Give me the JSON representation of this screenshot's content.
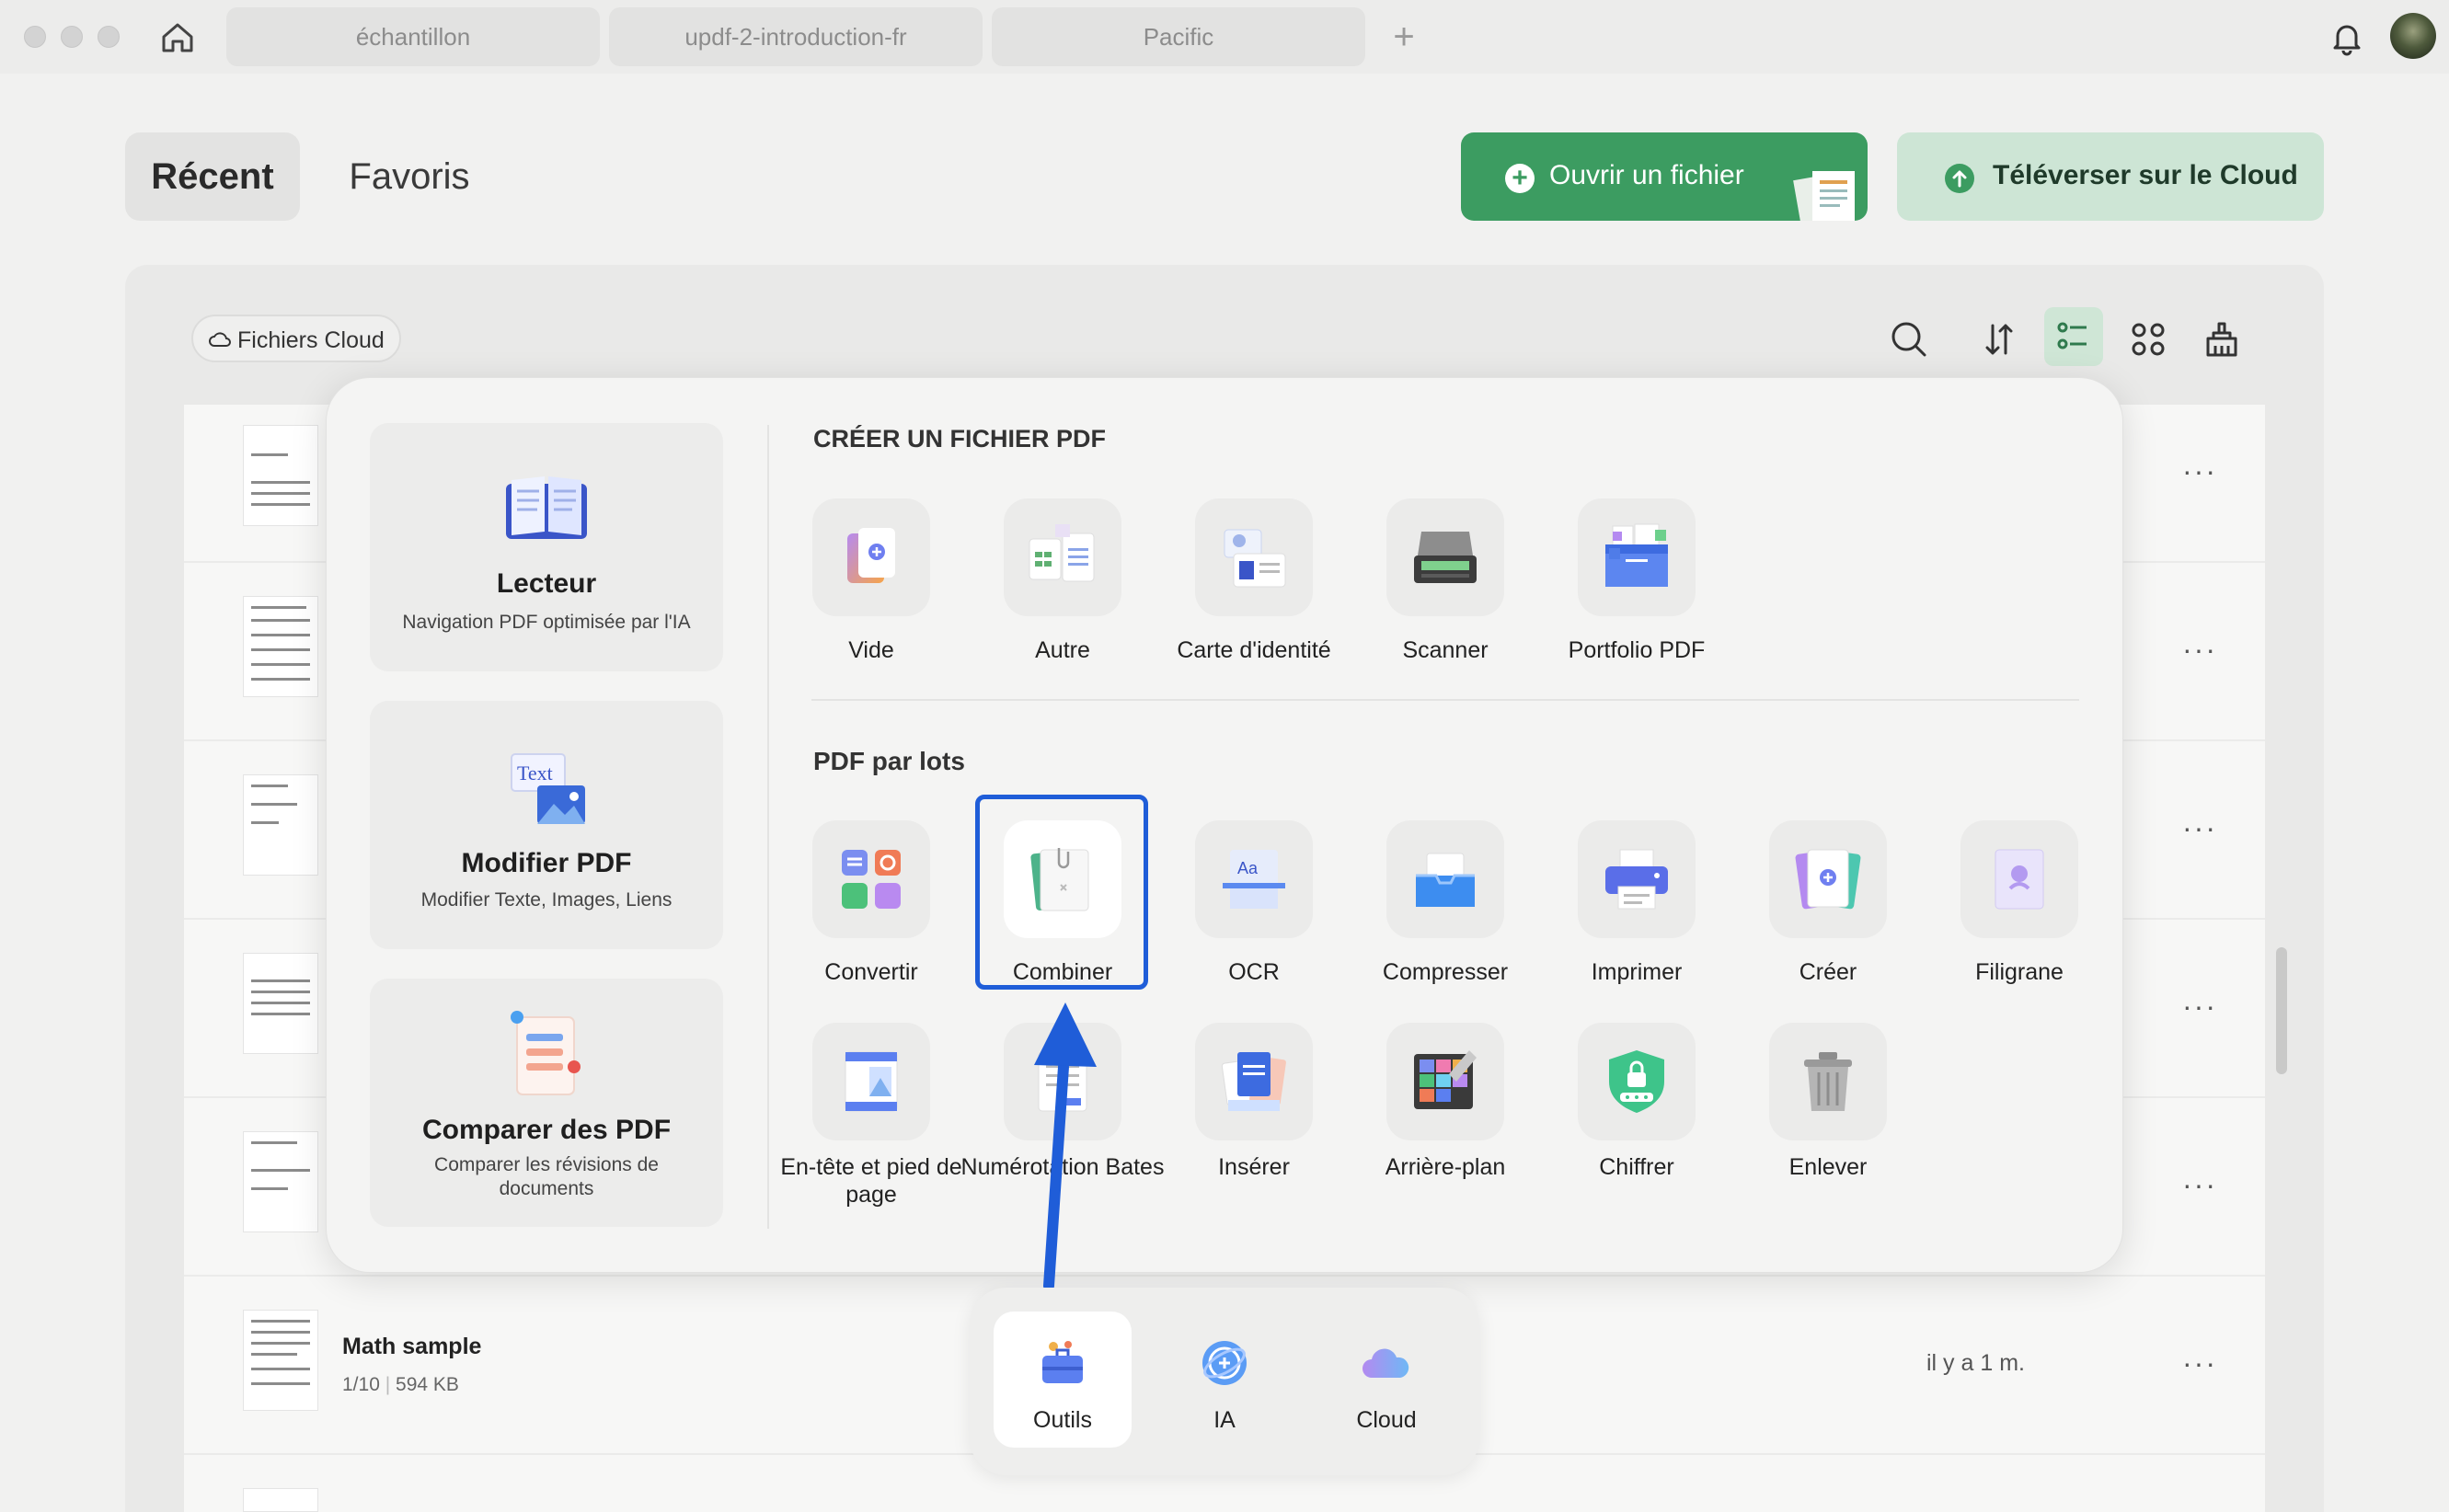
{
  "tabs": [
    {
      "label": "échantillon"
    },
    {
      "label": "updf-2-introduction-fr"
    },
    {
      "label": "Pacific"
    }
  ],
  "header": {
    "nav_recent": "Récent",
    "nav_favorites": "Favoris",
    "open_file": "Ouvrir un fichier",
    "upload_cloud": "Téléverser sur le Cloud"
  },
  "toolbar": {
    "cloud_files": "Fichiers Cloud"
  },
  "panel": {
    "cards": [
      {
        "title": "Lecteur",
        "subtitle": "Navigation PDF optimisée par l'IA"
      },
      {
        "title": "Modifier PDF",
        "subtitle": "Modifier Texte, Images, Liens"
      },
      {
        "title": "Comparer des PDF",
        "subtitle": "Comparer les révisions de documents"
      }
    ],
    "create_title": "CRÉER UN FICHIER PDF",
    "create_tools": [
      "Vide",
      "Autre",
      "Carte d'identité",
      "Scanner",
      "Portfolio PDF"
    ],
    "batch_title": "PDF par lots",
    "batch_tools_row1": [
      "Convertir",
      "Combiner",
      "OCR",
      "Compresser",
      "Imprimer",
      "Créer",
      "Filigrane"
    ],
    "batch_tools_row2": [
      "En-tête et pied de page",
      "Numérotation Bates",
      "Insérer",
      "Arrière-plan",
      "Chiffrer",
      "Enlever"
    ]
  },
  "files": {
    "visible": {
      "name": "Math sample",
      "pages": "1/10",
      "size": "594 KB",
      "time": "il y a 1 m."
    },
    "more_label": "···"
  },
  "dock": {
    "items": [
      "Outils",
      "IA",
      "Cloud"
    ]
  },
  "colors": {
    "accent_green": "#3c9c61",
    "highlight_blue": "#1f5dd8"
  }
}
